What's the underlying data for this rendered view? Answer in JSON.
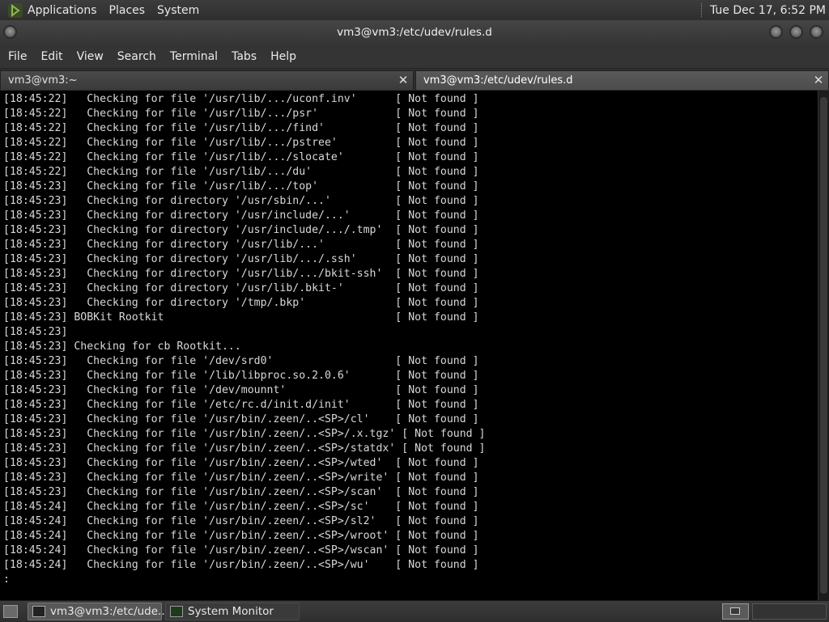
{
  "top_panel": {
    "menus": [
      "Applications",
      "Places",
      "System"
    ],
    "clock": "Tue Dec 17,  6:52 PM"
  },
  "window": {
    "title": "vm3@vm3:/etc/udev/rules.d"
  },
  "menubar": [
    "File",
    "Edit",
    "View",
    "Search",
    "Terminal",
    "Tabs",
    "Help"
  ],
  "tabs": [
    {
      "label": "vm3@vm3:~",
      "close": "✕"
    },
    {
      "label": "vm3@vm3:/etc/udev/rules.d",
      "close": "✕"
    }
  ],
  "terminal": {
    "lines": [
      "[18:45:22]   Checking for file '/usr/lib/.../uconf.inv'      [ Not found ]",
      "[18:45:22]   Checking for file '/usr/lib/.../psr'            [ Not found ]",
      "[18:45:22]   Checking for file '/usr/lib/.../find'           [ Not found ]",
      "[18:45:22]   Checking for file '/usr/lib/.../pstree'         [ Not found ]",
      "[18:45:22]   Checking for file '/usr/lib/.../slocate'        [ Not found ]",
      "[18:45:22]   Checking for file '/usr/lib/.../du'             [ Not found ]",
      "[18:45:23]   Checking for file '/usr/lib/.../top'            [ Not found ]",
      "[18:45:23]   Checking for directory '/usr/sbin/...'          [ Not found ]",
      "[18:45:23]   Checking for directory '/usr/include/...'       [ Not found ]",
      "[18:45:23]   Checking for directory '/usr/include/.../.tmp'  [ Not found ]",
      "[18:45:23]   Checking for directory '/usr/lib/...'           [ Not found ]",
      "[18:45:23]   Checking for directory '/usr/lib/.../.ssh'      [ Not found ]",
      "[18:45:23]   Checking for directory '/usr/lib/.../bkit-ssh'  [ Not found ]",
      "[18:45:23]   Checking for directory '/usr/lib/.bkit-'        [ Not found ]",
      "[18:45:23]   Checking for directory '/tmp/.bkp'              [ Not found ]",
      "[18:45:23] BOBKit Rootkit                                    [ Not found ]",
      "[18:45:23]",
      "[18:45:23] Checking for cb Rootkit...",
      "[18:45:23]   Checking for file '/dev/srd0'                   [ Not found ]",
      "[18:45:23]   Checking for file '/lib/libproc.so.2.0.6'       [ Not found ]",
      "[18:45:23]   Checking for file '/dev/mounnt'                 [ Not found ]",
      "[18:45:23]   Checking for file '/etc/rc.d/init.d/init'       [ Not found ]",
      "[18:45:23]   Checking for file '/usr/bin/.zeen/..<SP>/cl'    [ Not found ]",
      "[18:45:23]   Checking for file '/usr/bin/.zeen/..<SP>/.x.tgz' [ Not found ]",
      "[18:45:23]   Checking for file '/usr/bin/.zeen/..<SP>/statdx' [ Not found ]",
      "[18:45:23]   Checking for file '/usr/bin/.zeen/..<SP>/wted'  [ Not found ]",
      "[18:45:23]   Checking for file '/usr/bin/.zeen/..<SP>/write' [ Not found ]",
      "[18:45:23]   Checking for file '/usr/bin/.zeen/..<SP>/scan'  [ Not found ]",
      "[18:45:24]   Checking for file '/usr/bin/.zeen/..<SP>/sc'    [ Not found ]",
      "[18:45:24]   Checking for file '/usr/bin/.zeen/..<SP>/sl2'   [ Not found ]",
      "[18:45:24]   Checking for file '/usr/bin/.zeen/..<SP>/wroot' [ Not found ]",
      "[18:45:24]   Checking for file '/usr/bin/.zeen/..<SP>/wscan' [ Not found ]",
      "[18:45:24]   Checking for file '/usr/bin/.zeen/..<SP>/wu'    [ Not found ]",
      ":"
    ]
  },
  "taskbar": {
    "tasks": [
      {
        "label": "vm3@vm3:/etc/ude...",
        "icon": "terminal-icon"
      },
      {
        "label": "System Monitor",
        "icon": "system-monitor-icon"
      }
    ]
  },
  "colors": {
    "terminal_bg": "#000000",
    "terminal_fg": "#d8d8d8",
    "panel_bg": "#333333"
  }
}
